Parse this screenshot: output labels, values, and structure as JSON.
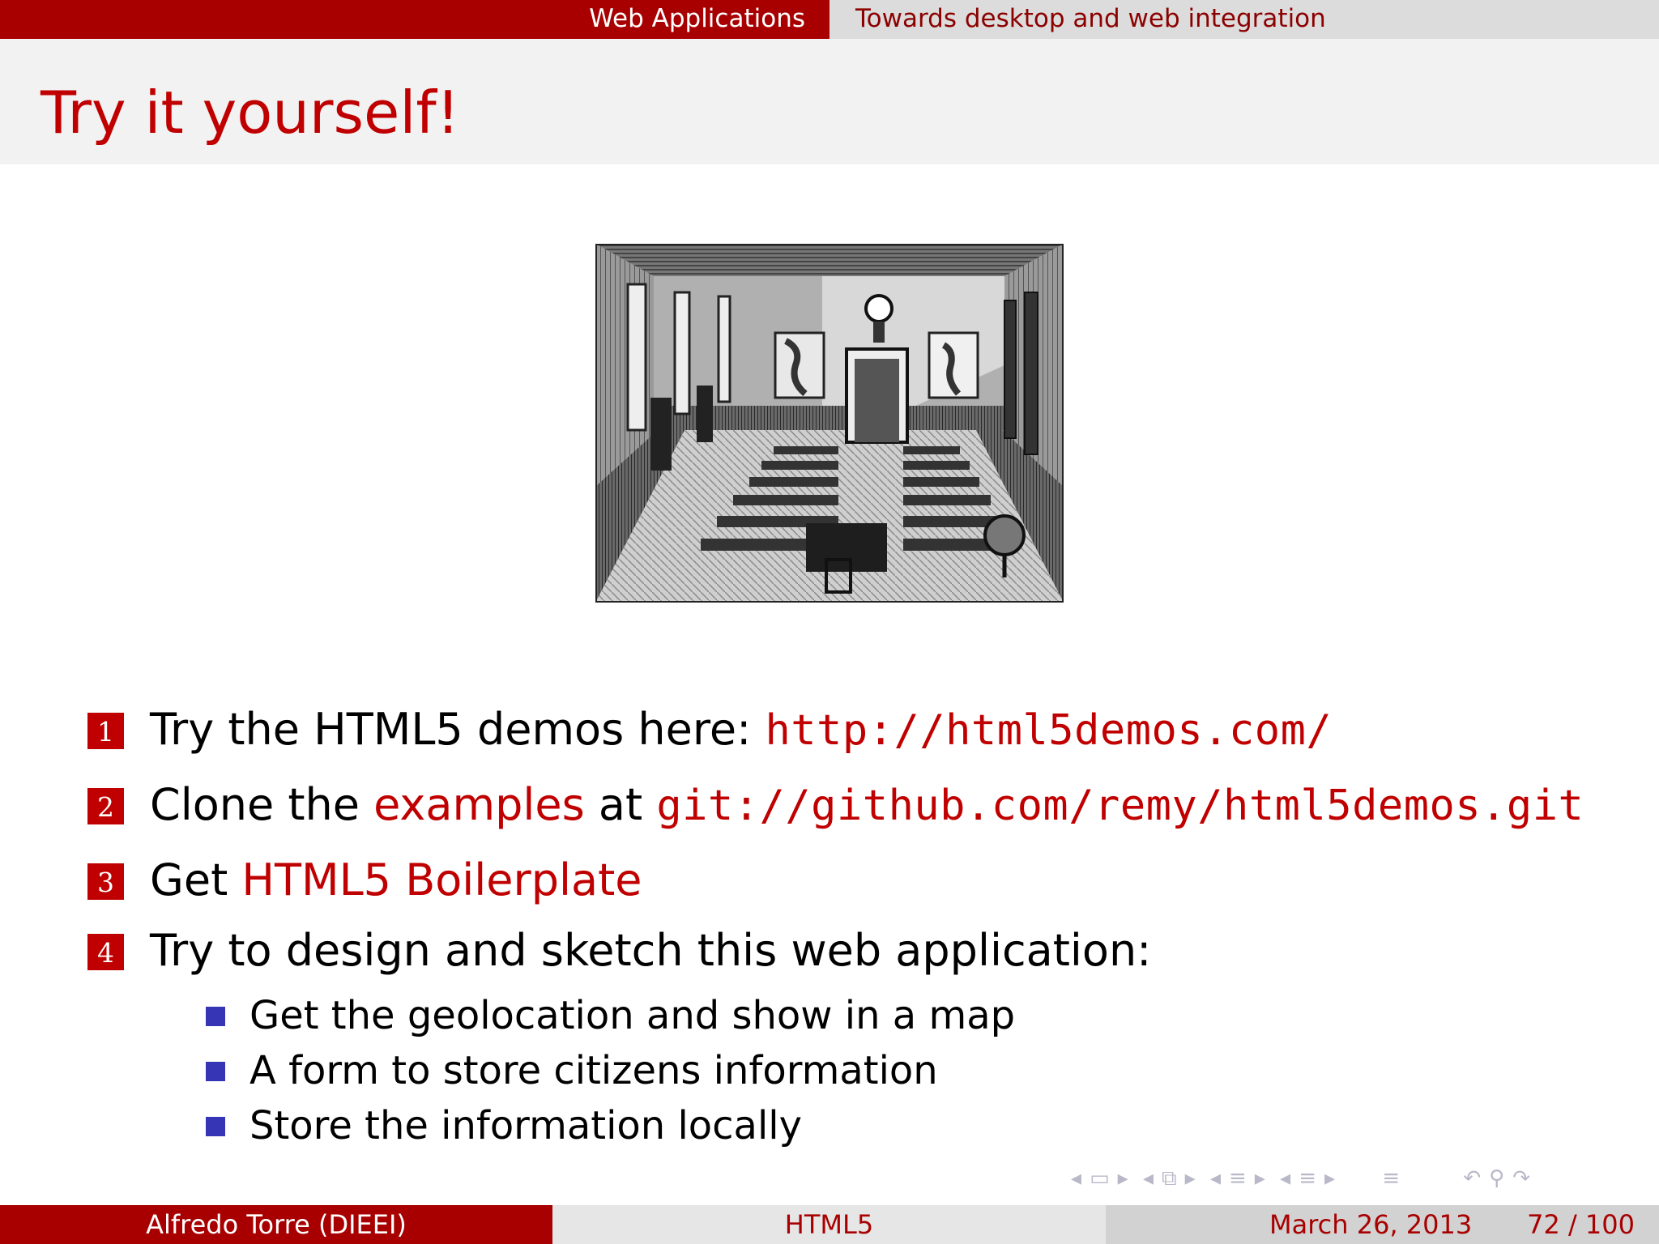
{
  "header": {
    "section": "Web Applications",
    "subsection": "Towards desktop and web integration"
  },
  "frame": {
    "title": "Try it yourself!"
  },
  "items": [
    {
      "num": "1",
      "text": "Try the HTML5 demos here: ",
      "code": "http://html5demos.com/"
    },
    {
      "num": "2",
      "text1": "Clone the ",
      "link": "examples",
      "text2": " at ",
      "code": "git://github.com/remy/html5demos.git"
    },
    {
      "num": "3",
      "text": "Get ",
      "link": "HTML5 Boilerplate"
    },
    {
      "num": "4",
      "text": "Try to design and sketch this web application:",
      "subitems": [
        "Get the geolocation and show in a map",
        "A form to store citizens information",
        "Store the information locally"
      ]
    }
  ],
  "footer": {
    "author": "Alfredo Torre  (DIEEI)",
    "short_title": "HTML5",
    "date": "March 26, 2013",
    "page": "72 / 100"
  },
  "colors": {
    "accent": "#c00000",
    "bar": "#a80000",
    "bullet": "#3535b5"
  },
  "icons": [
    "nav-prev-frame-icon",
    "nav-frame-icon",
    "nav-next-frame-icon",
    "nav-subsection-icon",
    "nav-section-icon",
    "nav-search-icon",
    "nav-undo-icon"
  ]
}
